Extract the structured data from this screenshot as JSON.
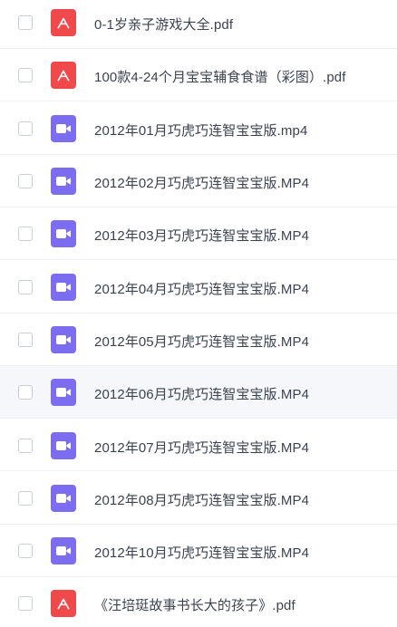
{
  "files": [
    {
      "name": "0-1岁亲子游戏大全.pdf",
      "type": "pdf",
      "icon": "pdf-icon"
    },
    {
      "name": "100款4-24个月宝宝辅食食谱（彩图）.pdf",
      "type": "pdf",
      "icon": "pdf-icon"
    },
    {
      "name": "2012年01月巧虎巧连智宝宝版.mp4",
      "type": "video",
      "icon": "video-icon"
    },
    {
      "name": "2012年02月巧虎巧连智宝宝版.MP4",
      "type": "video",
      "icon": "video-icon"
    },
    {
      "name": "2012年03月巧虎巧连智宝宝版.MP4",
      "type": "video",
      "icon": "video-icon"
    },
    {
      "name": "2012年04月巧虎巧连智宝宝版.MP4",
      "type": "video",
      "icon": "video-icon"
    },
    {
      "name": "2012年05月巧虎巧连智宝宝版.MP4",
      "type": "video",
      "icon": "video-icon"
    },
    {
      "name": "2012年06月巧虎巧连智宝宝版.MP4",
      "type": "video",
      "icon": "video-icon",
      "hovered": true
    },
    {
      "name": "2012年07月巧虎巧连智宝宝版.MP4",
      "type": "video",
      "icon": "video-icon"
    },
    {
      "name": "2012年08月巧虎巧连智宝宝版.MP4",
      "type": "video",
      "icon": "video-icon"
    },
    {
      "name": "2012年10月巧虎巧连智宝宝版.MP4",
      "type": "video",
      "icon": "video-icon"
    },
    {
      "name": "《汪培珽故事书长大的孩子》.pdf",
      "type": "pdf",
      "icon": "pdf-icon"
    }
  ],
  "colors": {
    "pdf": "#f0494c",
    "video": "#7b6cf0",
    "text": "#3b4350",
    "divider": "#eef0f4",
    "hover_bg": "#f5f7fb"
  }
}
